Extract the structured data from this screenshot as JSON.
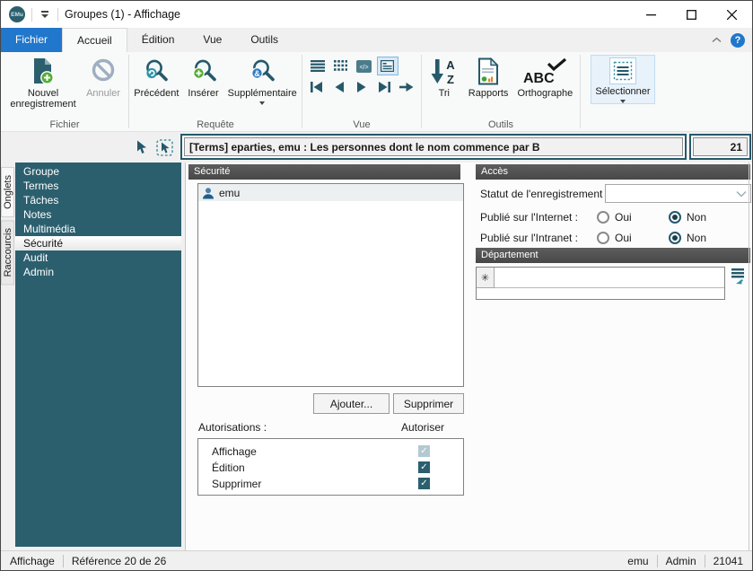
{
  "window": {
    "title": "Groupes (1) - Affichage",
    "logo_text": "EMu"
  },
  "menu_tabs": [
    {
      "label": "Fichier"
    },
    {
      "label": "Accueil"
    },
    {
      "label": "Édition"
    },
    {
      "label": "Vue"
    },
    {
      "label": "Outils"
    }
  ],
  "ribbon": {
    "group_captions": {
      "file": "Fichier",
      "query": "Requête",
      "view": "Vue",
      "tools": "Outils"
    },
    "buttons": {
      "new_record": "Nouvel enregistrement",
      "cancel": "Annuler",
      "previous": "Précédent",
      "insert": "Insérer",
      "extra": "Supplémentaire",
      "sort": "Tri",
      "reports": "Rapports",
      "spelling": "Orthographe",
      "select": "Sélectionner"
    },
    "icons": [
      "document-plus-icon",
      "cancel-icon",
      "search-back-icon",
      "search-plus-icon",
      "search-and-icon",
      "list-view-icon",
      "grid-view-icon",
      "code-view-icon",
      "form-view-icon",
      "first-record-icon",
      "previous-record-icon",
      "next-record-icon",
      "last-record-icon",
      "goto-record-icon",
      "sort-az-icon",
      "report-icon",
      "spellcheck-icon",
      "select-rows-icon"
    ]
  },
  "query_bar": {
    "text": "[Terms] eparties, emu : Les personnes dont le nom commence par B",
    "count": "21"
  },
  "sidebar": {
    "vertical_tabs": [
      {
        "label": "Onglets"
      },
      {
        "label": "Raccourcis"
      }
    ],
    "items": [
      {
        "label": "Groupe",
        "selected": false
      },
      {
        "label": "Termes",
        "selected": false
      },
      {
        "label": "Tâches",
        "selected": false
      },
      {
        "label": "Notes",
        "selected": false
      },
      {
        "label": "Multimédia",
        "selected": false
      },
      {
        "label": "Sécurité",
        "selected": true
      },
      {
        "label": "Audit",
        "selected": false
      },
      {
        "label": "Admin",
        "selected": false
      }
    ]
  },
  "security": {
    "header": "Sécurité",
    "users": [
      {
        "name": "emu"
      }
    ],
    "add_button": "Ajouter...",
    "delete_button": "Supprimer",
    "permissions_label": "Autorisations :",
    "allow_label": "Autoriser",
    "check_glyph": "✓",
    "permissions": [
      {
        "label": "Affichage",
        "checked": true,
        "disabled": true
      },
      {
        "label": "Édition",
        "checked": true,
        "disabled": false
      },
      {
        "label": "Supprimer",
        "checked": true,
        "disabled": false
      }
    ]
  },
  "access": {
    "header": "Accès",
    "record_status_label": "Statut de l'enregistrement :",
    "record_status_value": "",
    "internet_label": "Publié sur l'Internet :",
    "intranet_label": "Publié sur l'Intranet :",
    "yes_label": "Oui",
    "no_label": "Non",
    "internet_value": "Non",
    "intranet_value": "Non"
  },
  "department": {
    "header": "Département",
    "row_marker": "✳"
  },
  "status_bar": {
    "view_mode": "Affichage",
    "reference": "Référence 20 de 26",
    "user": "emu",
    "group": "Admin",
    "irn": "21041"
  },
  "colors": {
    "teal": "#2B5F6E",
    "header_gray": "#4D4D4D",
    "tab_blue": "#2077CC",
    "green": "#55AD35",
    "badge_blue": "#2E7BC4"
  }
}
